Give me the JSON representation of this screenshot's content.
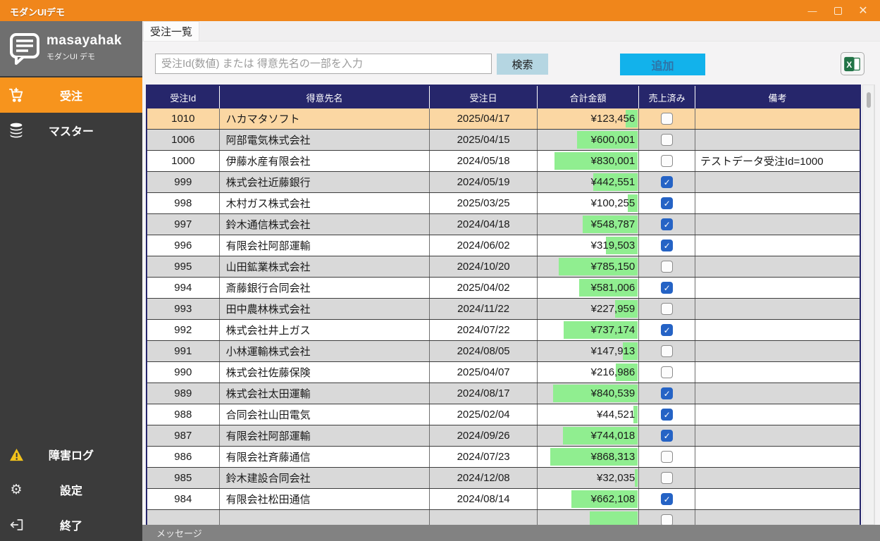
{
  "window": {
    "title": "モダンUIデモ"
  },
  "sidebar": {
    "logo": {
      "title": "masayahak",
      "subtitle": "モダンUI デモ"
    },
    "menu_top": [
      {
        "label": "受注",
        "icon": "cart-icon",
        "active": true
      },
      {
        "label": "マスター",
        "icon": "database-icon",
        "active": false
      }
    ],
    "menu_bottom": [
      {
        "label": "障害ログ",
        "icon": "warning-icon"
      },
      {
        "label": "設定",
        "icon": "gear-icon"
      },
      {
        "label": "終了",
        "icon": "exit-icon"
      }
    ]
  },
  "main": {
    "tab": "受注一覧",
    "search": {
      "placeholder": "受注Id(数値) または 得意先名の一部を入力",
      "search_label": "検索",
      "add_label": "追加",
      "excel_icon": "excel-export-icon"
    },
    "table": {
      "columns": [
        "受注Id",
        "得意先名",
        "受注日",
        "合計金額",
        "売上済み",
        "備考"
      ],
      "bar_scale_max": 1000000,
      "rows": [
        {
          "id": "1010",
          "name": "ハカマタソフト",
          "date": "2025/04/17",
          "amount": 123456,
          "amount_text": "¥123,456",
          "sold": false,
          "note": "",
          "selected": true
        },
        {
          "id": "1006",
          "name": "阿部電気株式会社",
          "date": "2025/04/15",
          "amount": 600001,
          "amount_text": "¥600,001",
          "sold": false,
          "note": ""
        },
        {
          "id": "1000",
          "name": "伊藤水産有限会社",
          "date": "2024/05/18",
          "amount": 830001,
          "amount_text": "¥830,001",
          "sold": false,
          "note": "テストデータ受注Id=1000"
        },
        {
          "id": "999",
          "name": "株式会社近藤銀行",
          "date": "2024/05/19",
          "amount": 442551,
          "amount_text": "¥442,551",
          "sold": true,
          "note": ""
        },
        {
          "id": "998",
          "name": "木村ガス株式会社",
          "date": "2025/03/25",
          "amount": 100255,
          "amount_text": "¥100,255",
          "sold": true,
          "note": ""
        },
        {
          "id": "997",
          "name": "鈴木通信株式会社",
          "date": "2024/04/18",
          "amount": 548787,
          "amount_text": "¥548,787",
          "sold": true,
          "note": ""
        },
        {
          "id": "996",
          "name": "有限会社阿部運輸",
          "date": "2024/06/02",
          "amount": 319503,
          "amount_text": "¥319,503",
          "sold": true,
          "note": ""
        },
        {
          "id": "995",
          "name": "山田鉱業株式会社",
          "date": "2024/10/20",
          "amount": 785150,
          "amount_text": "¥785,150",
          "sold": false,
          "note": ""
        },
        {
          "id": "994",
          "name": "斎藤銀行合同会社",
          "date": "2025/04/02",
          "amount": 581006,
          "amount_text": "¥581,006",
          "sold": true,
          "note": ""
        },
        {
          "id": "993",
          "name": "田中農林株式会社",
          "date": "2024/11/22",
          "amount": 227959,
          "amount_text": "¥227,959",
          "sold": false,
          "note": ""
        },
        {
          "id": "992",
          "name": "株式会社井上ガス",
          "date": "2024/07/22",
          "amount": 737174,
          "amount_text": "¥737,174",
          "sold": true,
          "note": ""
        },
        {
          "id": "991",
          "name": "小林運輸株式会社",
          "date": "2024/08/05",
          "amount": 147913,
          "amount_text": "¥147,913",
          "sold": false,
          "note": ""
        },
        {
          "id": "990",
          "name": "株式会社佐藤保険",
          "date": "2025/04/07",
          "amount": 216986,
          "amount_text": "¥216,986",
          "sold": false,
          "note": ""
        },
        {
          "id": "989",
          "name": "株式会社太田運輸",
          "date": "2024/08/17",
          "amount": 840539,
          "amount_text": "¥840,539",
          "sold": true,
          "note": ""
        },
        {
          "id": "988",
          "name": "合同会社山田電気",
          "date": "2025/02/04",
          "amount": 44521,
          "amount_text": "¥44,521",
          "sold": true,
          "note": ""
        },
        {
          "id": "987",
          "name": "有限会社阿部運輸",
          "date": "2024/09/26",
          "amount": 744018,
          "amount_text": "¥744,018",
          "sold": true,
          "note": ""
        },
        {
          "id": "986",
          "name": "有限会社斉藤通信",
          "date": "2024/07/23",
          "amount": 868313,
          "amount_text": "¥868,313",
          "sold": false,
          "note": ""
        },
        {
          "id": "985",
          "name": "鈴木建設合同会社",
          "date": "2024/12/08",
          "amount": 32035,
          "amount_text": "¥32,035",
          "sold": false,
          "note": ""
        },
        {
          "id": "984",
          "name": "有限会社松田通信",
          "date": "2024/08/14",
          "amount": 662108,
          "amount_text": "¥662,108",
          "sold": true,
          "note": ""
        },
        {
          "id": "",
          "name": "",
          "date": "",
          "amount": 480000,
          "amount_text": "",
          "sold": false,
          "note": "",
          "partial": true
        }
      ]
    },
    "status": "メッセージ"
  },
  "colors": {
    "titlebar_orange": "#F0861B",
    "active_orange": "#F7941D",
    "sidebar_dark": "#3B3B3B",
    "header_navy": "#26266B",
    "selected_row": "#FBD7A3",
    "alt_row": "#D9D9D9",
    "data_bar_green": "#90EE90",
    "checkbox_blue": "#2563C5",
    "add_button_cyan": "#12B2EB",
    "search_button_blue": "#B5D6E2",
    "excel_green": "#217346",
    "status_gray": "#828282"
  }
}
